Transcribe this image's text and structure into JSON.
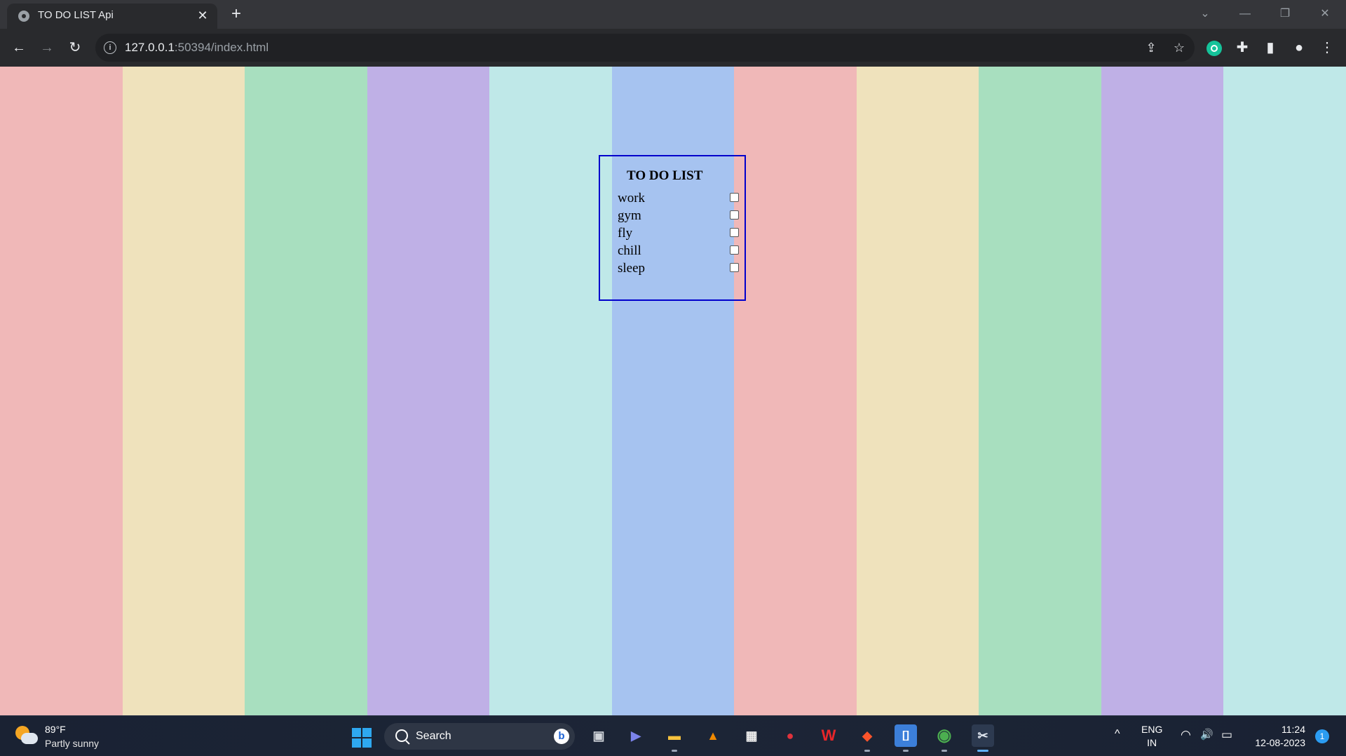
{
  "browser": {
    "tab": {
      "title": "TO DO LIST Api",
      "close_glyph": "✕",
      "favicon": "globe-icon"
    },
    "new_tab_glyph": "+",
    "window_controls": {
      "tab_search": "⌄",
      "minimize": "—",
      "restore": "❐",
      "close": "✕"
    },
    "nav": {
      "back": "←",
      "forward": "→",
      "reload": "↻"
    },
    "omnibox": {
      "info_glyph": "i",
      "host": "127.0.0.1",
      "rest": ":50394/index.html",
      "share": "⇪",
      "bookmark": "☆"
    },
    "extensions": {
      "puzzle": "✚",
      "side_panel": "▮",
      "profile": "●",
      "menu": "⋮"
    }
  },
  "page": {
    "title": "TO DO LIST",
    "items": [
      {
        "label": "work",
        "checked": false
      },
      {
        "label": "gym",
        "checked": false
      },
      {
        "label": "fly",
        "checked": false
      },
      {
        "label": "chill",
        "checked": false
      },
      {
        "label": "sleep",
        "checked": false
      }
    ],
    "stripe_colors": [
      "#f0b8b8",
      "#efe2bc",
      "#a8dfbf",
      "#bfb0e6",
      "#bfe8e8",
      "#a6c3f0"
    ],
    "border_color": "#0000cc"
  },
  "taskbar": {
    "weather": {
      "temp": "89°F",
      "desc": "Partly sunny"
    },
    "search": {
      "label": "Search",
      "bing_glyph": "b"
    },
    "apps": [
      {
        "name": "task-view",
        "glyph": "▣"
      },
      {
        "name": "meet",
        "glyph": "▶"
      },
      {
        "name": "file-explorer",
        "glyph": "▬"
      },
      {
        "name": "vlc",
        "glyph": "▲"
      },
      {
        "name": "store",
        "glyph": "▦"
      },
      {
        "name": "camera-recorder",
        "glyph": "●"
      },
      {
        "name": "wps-office",
        "glyph": "W"
      },
      {
        "name": "brave",
        "glyph": "◆"
      },
      {
        "name": "dev-app",
        "glyph": "[]"
      },
      {
        "name": "chrome",
        "glyph": "◉"
      },
      {
        "name": "snipping-tool",
        "glyph": "✂"
      }
    ],
    "tray": {
      "chevron": "^",
      "lang_line1": "ENG",
      "lang_line2": "IN",
      "wifi": "◠",
      "volume": "🔊",
      "battery": "▭",
      "time": "11:24",
      "date": "12-08-2023",
      "notifications": "1"
    }
  }
}
